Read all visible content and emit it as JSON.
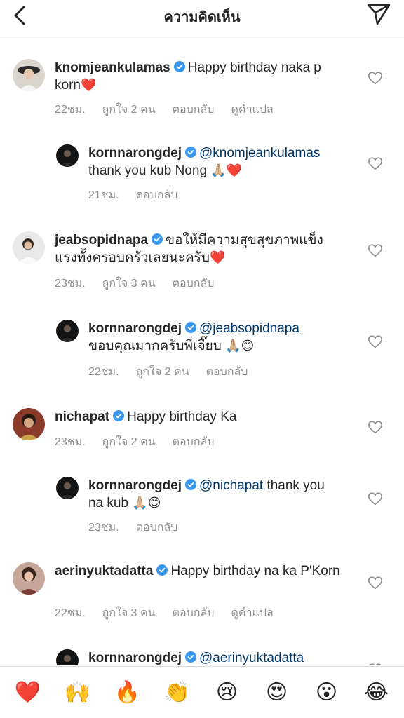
{
  "header": {
    "title": "ความคิดเห็น",
    "back_icon": "chevron-left-icon",
    "send_icon": "paper-plane-icon"
  },
  "colors": {
    "verified": "#3897f0",
    "mention": "#00376b",
    "heart_red": "#ed4956",
    "meta_gray": "#8e8e8e"
  },
  "comments": [
    {
      "username": "knomjeankulamas",
      "text": "Happy birthday naka p korn",
      "emoji": "❤️",
      "time": "22ชม.",
      "likes": "ถูกใจ 2 คน",
      "reply_label": "ตอบกลับ",
      "translate_label": "ดูคำแปล"
    },
    {
      "username": "kornnarongdej",
      "mention": "@knomjeankulamas",
      "text": "thank you kub Nong",
      "emoji": "🙏🏼❤️",
      "time": "21ชม.",
      "reply_label": "ตอบกลับ"
    },
    {
      "username": "jeabsopidnapa",
      "text": "ขอให้มีความสุขสุขภาพแข็งแรงทั้งครอบครัวเลยนะครับ",
      "emoji": "❤️",
      "time": "23ชม.",
      "likes": "ถูกใจ 3 คน",
      "reply_label": "ตอบกลับ"
    },
    {
      "username": "kornnarongdej",
      "mention": "@jeabsopidnapa",
      "text": "ขอบคุณมากครับพี่เจี๊ยบ",
      "emoji": "🙏🏼😊",
      "time": "22ชม.",
      "likes": "ถูกใจ 2 คน",
      "reply_label": "ตอบกลับ"
    },
    {
      "username": "nichapat",
      "text": "Happy birthday Ka",
      "time": "23ชม.",
      "likes": "ถูกใจ 2 คน",
      "reply_label": "ตอบกลับ"
    },
    {
      "username": "kornnarongdej",
      "mention": "@nichapat",
      "text": "thank you na kub",
      "emoji": "🙏🏼😊",
      "time": "23ชม.",
      "reply_label": "ตอบกลับ"
    },
    {
      "username": "aerinyuktadatta",
      "text": "Happy birthday na ka P'Korn",
      "time": "22ชม.",
      "likes": "ถูกใจ 3 คน",
      "reply_label": "ตอบกลับ",
      "translate_label": "ดูคำแปล"
    },
    {
      "username": "kornnarongdej",
      "mention": "@aerinyuktadatta"
    }
  ],
  "reactions": [
    "❤️",
    "🙌",
    "🔥",
    "👏",
    "😢",
    "😍",
    "😮",
    "😂"
  ]
}
